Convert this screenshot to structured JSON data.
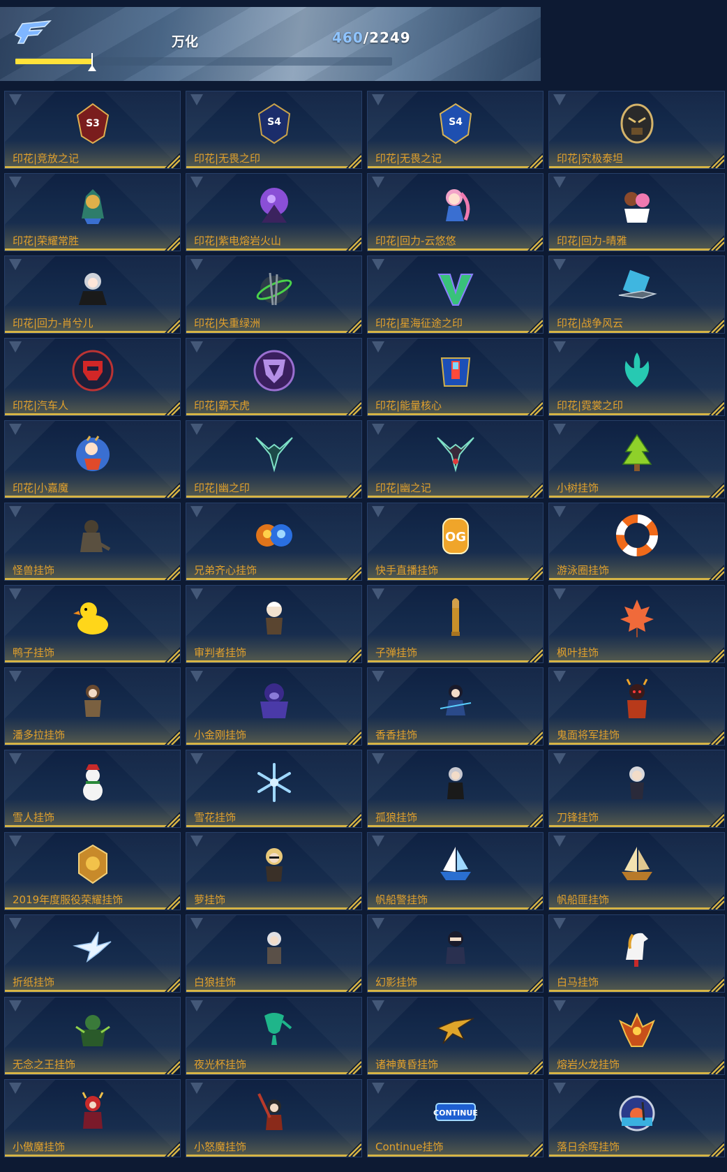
{
  "header": {
    "title": "万化",
    "current": "460",
    "separator": "/",
    "total": "2249",
    "progress": 0.2045,
    "logo_icon": "cf-logo-icon"
  },
  "colors": {
    "label": "#e2a12c",
    "accent_line": "#d6b445",
    "progress_fill": "#ffe23a",
    "count_current": "#8fc4ff"
  },
  "items": [
    {
      "label": "印花|竞放之记",
      "icon": "s3-badge-icon"
    },
    {
      "label": "印花|无畏之印",
      "icon": "s4-badge-icon"
    },
    {
      "label": "印花|无畏之记",
      "icon": "s4-badge-blue-icon"
    },
    {
      "label": "印花|究极泰坦",
      "icon": "titan-mask-icon"
    },
    {
      "label": "印花|荣耀常胜",
      "icon": "golden-warrior-icon"
    },
    {
      "label": "印花|紫电熔岩火山",
      "icon": "purple-volcano-icon"
    },
    {
      "label": "印花|回力-云悠悠",
      "icon": "pink-girl-icon"
    },
    {
      "label": "印花|回力-晴雅",
      "icon": "girl-duo-icon"
    },
    {
      "label": "印花|回力-肖兮儿",
      "icon": "silver-girl-icon"
    },
    {
      "label": "印花|失重绿洲",
      "icon": "green-oasis-icon"
    },
    {
      "label": "印花|星海征途之印",
      "icon": "green-v-emblem-icon"
    },
    {
      "label": "印花|战争风云",
      "icon": "war-jet-icon"
    },
    {
      "label": "印花|汽车人",
      "icon": "autobot-icon"
    },
    {
      "label": "印花|霸天虎",
      "icon": "decepticon-icon"
    },
    {
      "label": "印花|能量核心",
      "icon": "energy-core-icon"
    },
    {
      "label": "印花|霓裳之印",
      "icon": "cyan-flame-icon"
    },
    {
      "label": "印花|小嘉魔",
      "icon": "little-demon-icon"
    },
    {
      "label": "印花|幽之印",
      "icon": "ghost-wing-icon"
    },
    {
      "label": "印花|幽之记",
      "icon": "ghost-wing-red-icon"
    },
    {
      "label": "小树挂饰",
      "icon": "tree-icon"
    },
    {
      "label": "怪兽挂饰",
      "icon": "monster-icon"
    },
    {
      "label": "兄弟齐心挂饰",
      "icon": "brothers-icon"
    },
    {
      "label": "快手直播挂饰",
      "icon": "kuaishou-icon"
    },
    {
      "label": "游泳圈挂饰",
      "icon": "swim-ring-icon"
    },
    {
      "label": "鸭子挂饰",
      "icon": "duck-icon"
    },
    {
      "label": "审判者挂饰",
      "icon": "judge-icon"
    },
    {
      "label": "子弹挂饰",
      "icon": "bullet-icon"
    },
    {
      "label": "枫叶挂饰",
      "icon": "maple-leaf-icon"
    },
    {
      "label": "潘多拉挂饰",
      "icon": "pandora-icon"
    },
    {
      "label": "小金刚挂饰",
      "icon": "gorilla-icon"
    },
    {
      "label": "香香挂饰",
      "icon": "xiangxiang-icon"
    },
    {
      "label": "鬼面将军挂饰",
      "icon": "ghost-general-icon"
    },
    {
      "label": "雪人挂饰",
      "icon": "snowman-icon"
    },
    {
      "label": "雪花挂饰",
      "icon": "snowflake-icon"
    },
    {
      "label": "孤狼挂饰",
      "icon": "lone-wolf-icon"
    },
    {
      "label": "刀锋挂饰",
      "icon": "blade-icon"
    },
    {
      "label": "2019年度服役荣耀挂饰",
      "icon": "honor-badge-icon"
    },
    {
      "label": "萝挂饰",
      "icon": "blonde-girl-icon"
    },
    {
      "label": "帆船警挂饰",
      "icon": "police-ship-icon"
    },
    {
      "label": "帆船匪挂饰",
      "icon": "pirate-ship-icon"
    },
    {
      "label": "折纸挂饰",
      "icon": "paper-crane-icon"
    },
    {
      "label": "白狼挂饰",
      "icon": "white-wolf-icon"
    },
    {
      "label": "幻影挂饰",
      "icon": "phantom-icon"
    },
    {
      "label": "白马挂饰",
      "icon": "white-horse-icon"
    },
    {
      "label": "无念之王挂饰",
      "icon": "green-king-icon"
    },
    {
      "label": "夜光杯挂饰",
      "icon": "glow-cup-icon"
    },
    {
      "label": "诸神黄昏挂饰",
      "icon": "gold-dragon-icon"
    },
    {
      "label": "熔岩火龙挂饰",
      "icon": "lava-dragon-icon"
    },
    {
      "label": "小傲魔挂饰",
      "icon": "proud-demon-icon"
    },
    {
      "label": "小怒魔挂饰",
      "icon": "angry-demon-icon"
    },
    {
      "label": "Continue挂饰",
      "icon": "continue-icon"
    },
    {
      "label": "落日余晖挂饰",
      "icon": "sunset-icon"
    }
  ]
}
